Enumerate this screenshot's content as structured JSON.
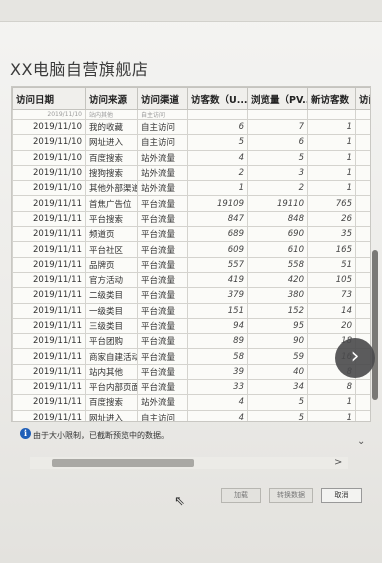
{
  "title": "XX电脑自营旗舰店",
  "columns": [
    "访问日期",
    "访问来源",
    "访问渠道",
    "访客数（U...",
    "浏览量（PV...",
    "新访客数",
    "访问次"
  ],
  "partial_row": [
    "2019/11/10",
    "站内其他",
    "自主访问",
    "",
    "",
    "",
    ""
  ],
  "rows": [
    [
      "2019/11/10",
      "我的收藏",
      "自主访问",
      "6",
      "7",
      "1"
    ],
    [
      "2019/11/10",
      "网址进入",
      "自主访问",
      "5",
      "6",
      "1"
    ],
    [
      "2019/11/10",
      "百度搜索",
      "站外流量",
      "4",
      "5",
      "1"
    ],
    [
      "2019/11/10",
      "搜狗搜索",
      "站外流量",
      "2",
      "3",
      "1"
    ],
    [
      "2019/11/10",
      "其他外部渠道",
      "站外流量",
      "1",
      "2",
      "1"
    ],
    [
      "2019/11/11",
      "首焦广告位",
      "平台流量",
      "19109",
      "19110",
      "765"
    ],
    [
      "2019/11/11",
      "平台搜索",
      "平台流量",
      "847",
      "848",
      "26"
    ],
    [
      "2019/11/11",
      "频道页",
      "平台流量",
      "689",
      "690",
      "35"
    ],
    [
      "2019/11/11",
      "平台社区",
      "平台流量",
      "609",
      "610",
      "165"
    ],
    [
      "2019/11/11",
      "品牌页",
      "平台流量",
      "557",
      "558",
      "51"
    ],
    [
      "2019/11/11",
      "官方活动",
      "平台流量",
      "419",
      "420",
      "105"
    ],
    [
      "2019/11/11",
      "二级类目",
      "平台流量",
      "379",
      "380",
      "73"
    ],
    [
      "2019/11/11",
      "一级类目",
      "平台流量",
      "151",
      "152",
      "14"
    ],
    [
      "2019/11/11",
      "三级类目",
      "平台流量",
      "94",
      "95",
      "20"
    ],
    [
      "2019/11/11",
      "平台团购",
      "平台流量",
      "89",
      "90",
      "18"
    ],
    [
      "2019/11/11",
      "商家自建活动",
      "平台流量",
      "58",
      "59",
      "16"
    ],
    [
      "2019/11/11",
      "站内其他",
      "平台流量",
      "39",
      "40",
      "8"
    ],
    [
      "2019/11/11",
      "平台内部页面",
      "平台流量",
      "33",
      "34",
      "8"
    ],
    [
      "2019/11/11",
      "百度搜索",
      "站外流量",
      "4",
      "5",
      "1"
    ],
    [
      "2019/11/11",
      "网址进入",
      "自主访问",
      "4",
      "5",
      "1"
    ]
  ],
  "note": "由于大小限制，已截断预览中的数据。",
  "buttons": {
    "load": "加载",
    "transform": "转换数据",
    "cancel": "取消"
  },
  "scroll_left": "<",
  "scroll_right": ">",
  "scroll_down": "⌄",
  "next_icon": "›"
}
